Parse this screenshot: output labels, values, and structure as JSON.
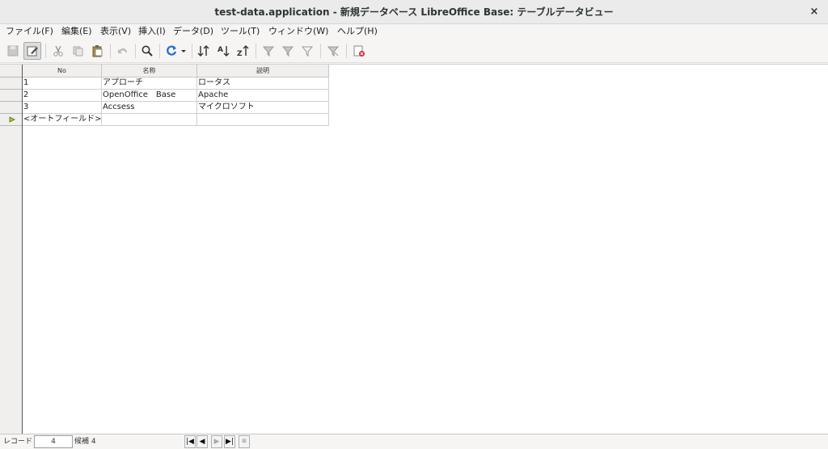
{
  "window": {
    "title": "test-data.application - 新規データベース  LibreOffice Base: テーブルデータビュー",
    "close_glyph": "×"
  },
  "menu": [
    {
      "label": "ファイル(F)"
    },
    {
      "label": "編集(E)"
    },
    {
      "label": "表示(V)"
    },
    {
      "label": "挿入(I)"
    },
    {
      "label": "データ(D)"
    },
    {
      "label": "ツール(T)"
    },
    {
      "label": "ウィンドウ(W)"
    },
    {
      "label": "ヘルプ(H)"
    }
  ],
  "toolbar": {
    "icons": [
      "save-record-icon",
      "edit-data-icon",
      "cut-icon",
      "copy-icon",
      "paste-icon",
      "undo-icon",
      "find-record-icon",
      "refresh-icon",
      "sort-icon",
      "sort-ascending-icon",
      "sort-descending-icon",
      "autofilter-icon",
      "standard-filter-icon",
      "apply-filter-icon",
      "remove-filter-icon",
      "delete-record-icon"
    ]
  },
  "table": {
    "headers": [
      "No",
      "名称",
      "説明"
    ],
    "rows": [
      [
        "1",
        "アプローチ",
        "ロータス"
      ],
      [
        "2",
        "OpenOffice　Base",
        "Apache"
      ],
      [
        "3",
        "Accsess",
        "マイクロソフト"
      ],
      [
        "<オートフィールド>",
        "",
        ""
      ]
    ]
  },
  "status": {
    "record_label": "レコード",
    "record_value": "4",
    "candidate_label": "候補 4"
  },
  "nav": {
    "first": "|◀",
    "prev": "◀",
    "next": "▶",
    "last": "▶|",
    "new": "✱"
  },
  "colors": {
    "accent_blue": "#1e6fd0",
    "delete_red": "#d9272e",
    "new_row_marker": "#e8b400"
  }
}
